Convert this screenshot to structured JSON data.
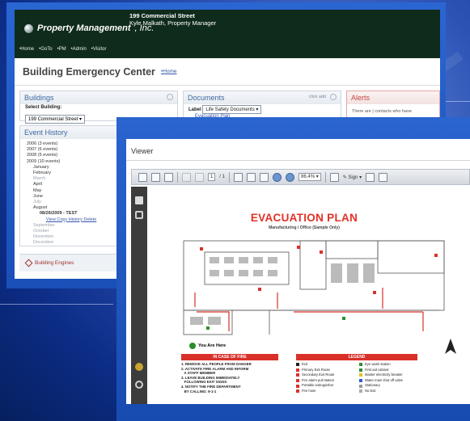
{
  "back_window": {
    "logo": {
      "name": "Property Management",
      "suffix": ", Inc."
    },
    "address": {
      "line1": "199 Commercial Street",
      "line2": "Kyle Malkath, Property Manager"
    },
    "nav": [
      "•Home",
      "•GoTo",
      "•PM",
      "•Admin",
      "•Visitor"
    ],
    "page_title": "Building Emergency Center",
    "home_link": "•Home",
    "buildings": {
      "title": "Buildings",
      "select_label": "Select Building:",
      "selected": "199 Commercial Street"
    },
    "documents": {
      "title": "Documents",
      "add_label": "click add",
      "label_text": "Label",
      "selected": "Life Safety Documents",
      "item": "Evacuation Plan"
    },
    "alerts": {
      "title": "Alerts",
      "text": "There are | contacts who have"
    },
    "event_history": {
      "title": "Event History",
      "items": [
        {
          "text": "2006 (3 events)",
          "cls": ""
        },
        {
          "text": "2007 (6 events)",
          "cls": ""
        },
        {
          "text": "2008 (5 events)",
          "cls": ""
        },
        {
          "text": "2009 (10 events)",
          "cls": ""
        },
        {
          "text": "January",
          "cls": "i1"
        },
        {
          "text": "February",
          "cls": "i1"
        },
        {
          "text": "March",
          "cls": "i1 gray"
        },
        {
          "text": "April",
          "cls": "i1"
        },
        {
          "text": "May",
          "cls": "i1"
        },
        {
          "text": "June",
          "cls": "i1"
        },
        {
          "text": "July",
          "cls": "i1 gray"
        },
        {
          "text": "August",
          "cls": "i1"
        },
        {
          "text": "08/26/2009 - TEST",
          "cls": "i2 bold"
        }
      ],
      "actions": "View Copy History Delete",
      "after": [
        "September",
        "October",
        "November",
        "December"
      ]
    },
    "footer": "Building Engines"
  },
  "viewer": {
    "title": "Viewer",
    "page_current": "1",
    "page_total": "/ 1",
    "zoom": "86.4%",
    "sign_label": "Sign"
  },
  "plan": {
    "title": "EVACUATION PLAN",
    "subtitle": "Manufacturing / Office (Sample Only)",
    "you_are_here": "You Are Here",
    "fire_header": "IN CASE OF FIRE",
    "legend_header": "LEGEND",
    "instructions": [
      "1. REMOVE ALL PEOPLE FROM DANGER",
      "2. ACTIVATE FIRE ALARM AND INFORM",
      "   A STAFF MEMBER",
      "3. LEAVE BUILDING IMMEDIATELY",
      "   FOLLOWING EXIT SIGNS",
      "4. NOTIFY THE FIRE DEPARTMENT",
      "   BY CALLING: 9-1-1"
    ],
    "legend": [
      {
        "label": "Exit",
        "color": "#222222"
      },
      {
        "label": "Eye wash station",
        "color": "#2f8f2f"
      },
      {
        "label": "Primary Exit Route",
        "color": "#d9312a"
      },
      {
        "label": "First aid cabinet",
        "color": "#2f8f2f"
      },
      {
        "label": "Secondary Exit Route",
        "color": "#d9312a"
      },
      {
        "label": "Master electricity breaker",
        "color": "#e0c21a"
      },
      {
        "label": "Fire alarm pull station",
        "color": "#d9312a"
      },
      {
        "label": "Water main shut off valve",
        "color": "#2d5fd0"
      },
      {
        "label": "Portable extinguisher",
        "color": "#d9312a"
      },
      {
        "label": "Stationary",
        "color": "#999999"
      },
      {
        "label": "Fire hose",
        "color": "#d9312a"
      },
      {
        "label": "No Exit",
        "color": "#aaaaaa"
      }
    ]
  }
}
